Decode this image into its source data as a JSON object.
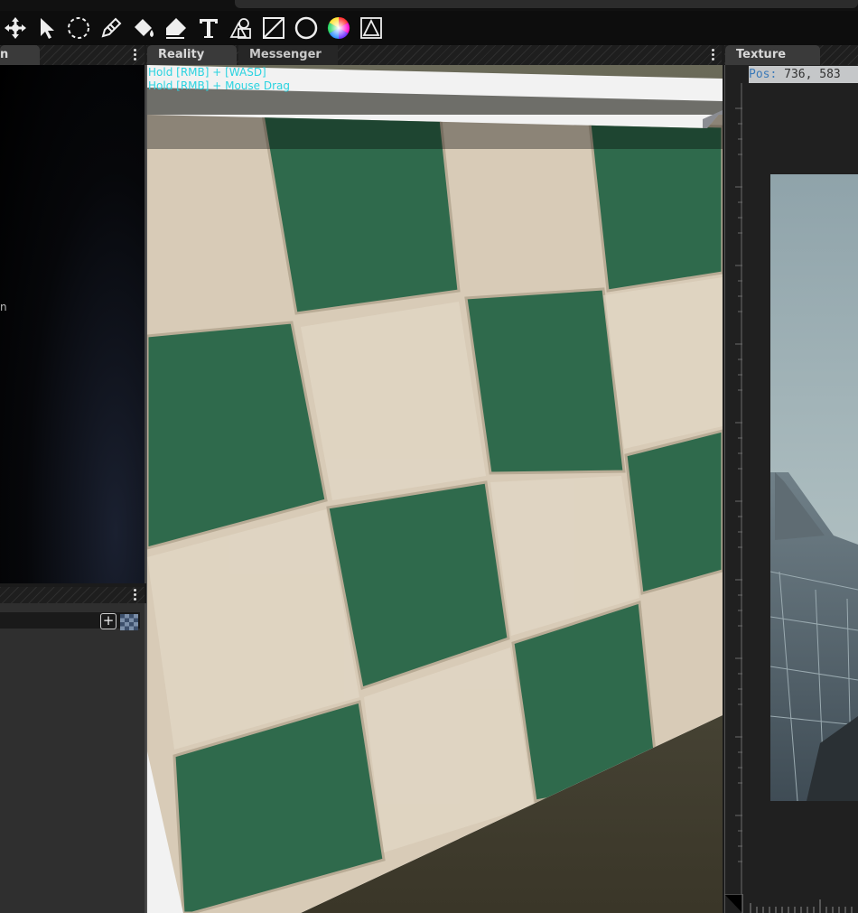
{
  "toolbar": {
    "tools": [
      "move-icon",
      "select-arrow-icon",
      "lasso-select-icon",
      "pencil-icon",
      "fill-bucket-icon",
      "eraser-icon",
      "text-icon",
      "shapes-icon",
      "line-icon",
      "ellipse-icon",
      "color-wheel-icon",
      "transform-icon"
    ]
  },
  "left_panel": {
    "tab_label": "n",
    "side_mark": "n"
  },
  "center_panel": {
    "tabs": [
      {
        "label": "Reality",
        "active": true
      },
      {
        "label": "Messenger",
        "active": false
      }
    ],
    "hints": [
      "Hold [RMB] + [WASD]",
      "Hold [RMB] + Mouse Drag"
    ],
    "hint_color": "#2ad3e0"
  },
  "right_panel": {
    "tab_label": "Texture",
    "pos_label": "Pos:",
    "pos_value": "736, 583"
  },
  "colors": {
    "tile_green": "#2f6a4c",
    "tile_cream": "#d8cbb7",
    "frame": "#f2f2f2",
    "toolbar_bg": "#0d0d0d"
  }
}
